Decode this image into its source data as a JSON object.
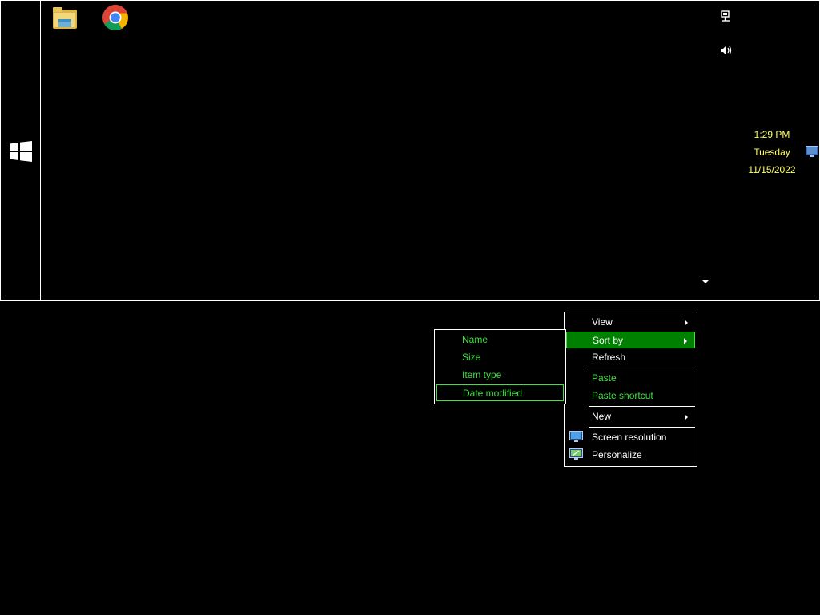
{
  "taskbar": {
    "pinned": [
      {
        "name": "File Explorer",
        "icon": "folder-icon"
      },
      {
        "name": "Google Chrome",
        "icon": "chrome-icon"
      }
    ],
    "tray": {
      "network_icon": "network-icon",
      "volume_icon": "speaker-icon"
    },
    "clock": {
      "time": "1:29 PM",
      "day": "Tuesday",
      "date": "11/15/2022"
    }
  },
  "context_menu": {
    "view": "View",
    "sort_by": "Sort by",
    "refresh": "Refresh",
    "paste": "Paste",
    "paste_shortcut": "Paste shortcut",
    "new": "New",
    "screen_resolution": "Screen resolution",
    "personalize": "Personalize"
  },
  "sort_submenu": {
    "name": "Name",
    "size": "Size",
    "item_type": "Item type",
    "date_modified": "Date modified"
  },
  "colors": {
    "background": "#000000",
    "highlight": "#008000",
    "green_text": "#3fe03f",
    "clock_text": "#ffff66"
  }
}
